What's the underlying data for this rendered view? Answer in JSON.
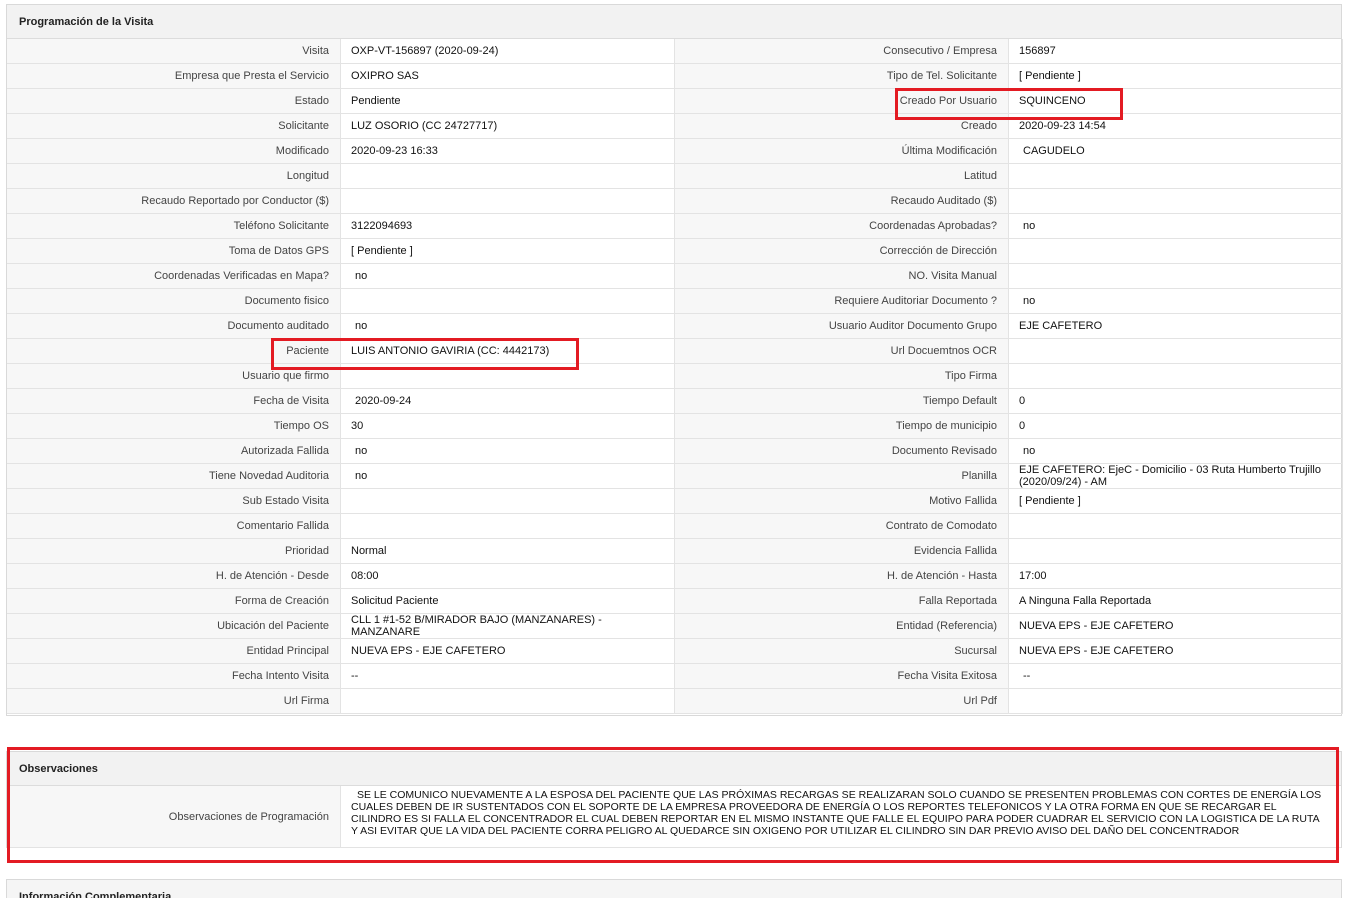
{
  "programacion": {
    "title": "Programación de la Visita",
    "rows": [
      {
        "l1": "Visita",
        "v1": "OXP-VT-156897 (2020-09-24)",
        "l2": "Consecutivo / Empresa",
        "v2": "156897"
      },
      {
        "l1": "Empresa que Presta el Servicio",
        "v1": "OXIPRO SAS",
        "l2": "Tipo de Tel. Solicitante",
        "v2": "[ Pendiente ]"
      },
      {
        "l1": "Estado",
        "v1": "Pendiente",
        "l2": "Creado Por Usuario",
        "v2": "SQUINCENO"
      },
      {
        "l1": "Solicitante",
        "v1": "LUZ OSORIO (CC 24727717)",
        "l2": "Creado",
        "v2": "2020-09-23 14:54"
      },
      {
        "l1": "Modificado",
        "v1": "2020-09-23 16:33",
        "l2": "Última Modificación",
        "v2": "CAGUDELO"
      },
      {
        "l1": "Longitud",
        "v1": "",
        "l2": "Latitud",
        "v2": ""
      },
      {
        "l1": "Recaudo Reportado por Conductor ($)",
        "v1": "",
        "l2": "Recaudo Auditado ($)",
        "v2": ""
      },
      {
        "l1": "Teléfono Solicitante",
        "v1": "3122094693",
        "l2": "Coordenadas Aprobadas?",
        "v2": "no"
      },
      {
        "l1": "Toma de Datos GPS",
        "v1": "[ Pendiente ]",
        "l2": "Corrección de Dirección",
        "v2": ""
      },
      {
        "l1": "Coordenadas Verificadas en Mapa?",
        "v1": "no",
        "l2": "NO. Visita Manual",
        "v2": ""
      },
      {
        "l1": "Documento fisico",
        "v1": "",
        "l2": "Requiere Auditoriar Documento ?",
        "v2": "no"
      },
      {
        "l1": "Documento auditado",
        "v1": "no",
        "l2": "Usuario Auditor Documento Grupo",
        "v2": "EJE CAFETERO"
      },
      {
        "l1": "Paciente",
        "v1": "LUIS ANTONIO GAVIRIA (CC: 4442173)",
        "l2": "Url Docuemtnos OCR",
        "v2": ""
      },
      {
        "l1": "Usuario que firmo",
        "v1": "",
        "l2": "Tipo Firma",
        "v2": ""
      },
      {
        "l1": "Fecha de Visita",
        "v1": "2020-09-24",
        "l2": "Tiempo Default",
        "v2": "0"
      },
      {
        "l1": "Tiempo OS",
        "v1": "30",
        "l2": "Tiempo de municipio",
        "v2": "0"
      },
      {
        "l1": "Autorizada Fallida",
        "v1": "no",
        "l2": "Documento Revisado",
        "v2": "no"
      },
      {
        "l1": "Tiene Novedad Auditoria",
        "v1": "no",
        "l2": "Planilla",
        "v2": "EJE CAFETERO: EjeC - Domicilio - 03 Ruta Humberto Trujillo (2020/09/24) - AM"
      },
      {
        "l1": "Sub Estado Visita",
        "v1": "",
        "l2": "Motivo Fallida",
        "v2": "[ Pendiente ]"
      },
      {
        "l1": "Comentario Fallida",
        "v1": "",
        "l2": "Contrato de Comodato",
        "v2": ""
      },
      {
        "l1": "Prioridad",
        "v1": "Normal",
        "l2": "Evidencia Fallida",
        "v2": ""
      },
      {
        "l1": "H. de Atención - Desde",
        "v1": "08:00",
        "l2": "H. de Atención - Hasta",
        "v2": "17:00"
      },
      {
        "l1": "Forma de Creación",
        "v1": "Solicitud Paciente",
        "l2": "Falla Reportada",
        "v2": "A Ninguna Falla Reportada"
      },
      {
        "l1": "Ubicación del Paciente",
        "v1": "CLL 1 #1-52 B/MIRADOR BAJO (MANZANARES) - MANZANARE",
        "l2": "Entidad (Referencia)",
        "v2": "NUEVA EPS - EJE CAFETERO"
      },
      {
        "l1": "Entidad Principal",
        "v1": "NUEVA EPS - EJE CAFETERO",
        "l2": "Sucursal",
        "v2": "NUEVA EPS - EJE CAFETERO"
      },
      {
        "l1": "Fecha Intento Visita",
        "v1": "--",
        "l2": "Fecha Visita Exitosa",
        "v2": "--"
      },
      {
        "l1": "Url Firma",
        "v1": "",
        "l2": "Url Pdf",
        "v2": ""
      }
    ]
  },
  "observaciones": {
    "title": "Observaciones",
    "label": "Observaciones de Programación",
    "text": "SE LE COMUNICO NUEVAMENTE A LA ESPOSA DEL PACIENTE QUE LAS PRÓXIMAS RECARGAS SE REALIZARAN SOLO CUANDO SE PRESENTEN PROBLEMAS CON CORTES DE ENERGÍA LOS CUALES DEBEN DE IR SUSTENTADOS CON EL SOPORTE DE LA EMPRESA PROVEEDORA DE ENERGÍA O LOS REPORTES TELEFONICOS Y LA OTRA FORMA EN QUE SE RECARGAR EL CILINDRO ES SI FALLA EL CONCENTRADOR EL CUAL DEBEN REPORTAR EN EL MISMO INSTANTE QUE FALLE EL EQUIPO PARA PODER CUADRAR EL SERVICIO CON LA LOGISTICA DE LA RUTA Y ASI EVITAR QUE LA VIDA DEL PACIENTE CORRA PELIGRO AL QUEDARCE SIN OXIGENO POR UTILIZAR EL CILINDRO SIN DAR PREVIO AVISO DEL DAÑO DEL CONCENTRADOR"
  },
  "informacion": {
    "title": "Información Complementaria"
  },
  "highlight_color": "#e31b23"
}
